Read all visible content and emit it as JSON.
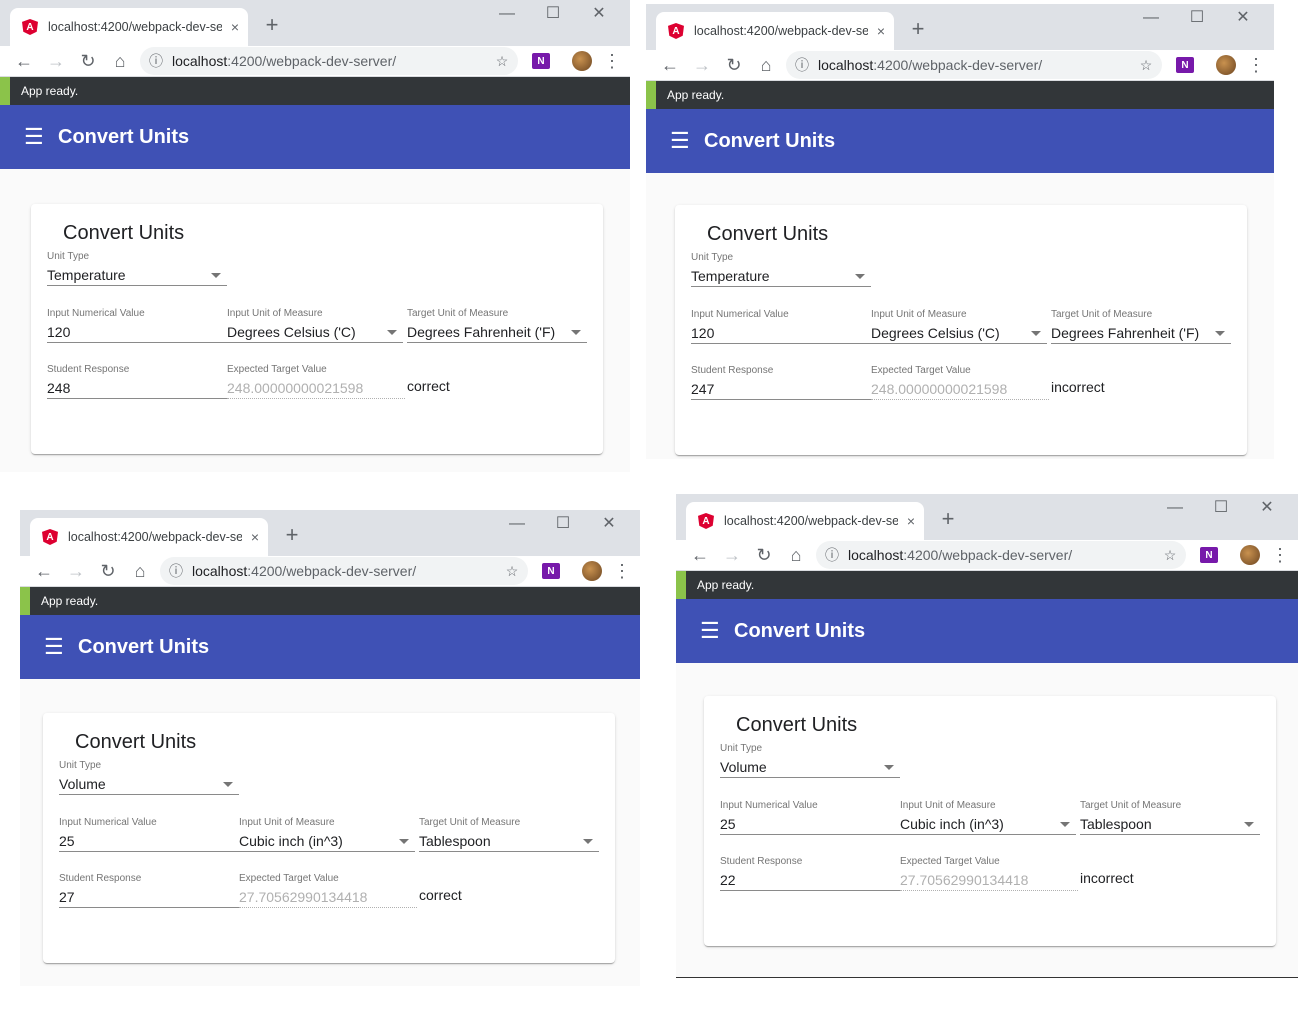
{
  "browser": {
    "tab_title": "localhost:4200/webpack-dev-server/",
    "tab_close": "×",
    "new_tab": "+",
    "window_controls": [
      "—",
      "☐",
      "✕"
    ],
    "url_host": "localhost",
    "url_rest": ":4200/webpack-dev-server/",
    "favicon_letter": "A",
    "onenote_letter": "N"
  },
  "toast": "App ready.",
  "app_title": "Convert Units",
  "card_title": "Convert Units",
  "labels": {
    "unit_type": "Unit Type",
    "input_value": "Input Numerical Value",
    "input_unit": "Input Unit of Measure",
    "target_unit": "Target Unit of Measure",
    "student_response": "Student Response",
    "expected_value": "Expected Target Value"
  },
  "windows": [
    {
      "unit_type": "Temperature",
      "input_value": "120",
      "input_unit": "Degrees Celsius ('C)",
      "target_unit": "Degrees Fahrenheit ('F)",
      "student_response": "248",
      "expected_value": "248.00000000021598",
      "result": "correct"
    },
    {
      "unit_type": "Temperature",
      "input_value": "120",
      "input_unit": "Degrees Celsius ('C)",
      "target_unit": "Degrees Fahrenheit ('F)",
      "student_response": "247",
      "expected_value": "248.00000000021598",
      "result": "incorrect"
    },
    {
      "unit_type": "Volume",
      "input_value": "25",
      "input_unit": "Cubic inch (in^3)",
      "target_unit": "Tablespoon",
      "student_response": "27",
      "expected_value": "27.70562990134418",
      "result": "correct"
    },
    {
      "unit_type": "Volume",
      "input_value": "25",
      "input_unit": "Cubic inch (in^3)",
      "target_unit": "Tablespoon",
      "student_response": "22",
      "expected_value": "27.70562990134418",
      "result": "incorrect"
    }
  ]
}
